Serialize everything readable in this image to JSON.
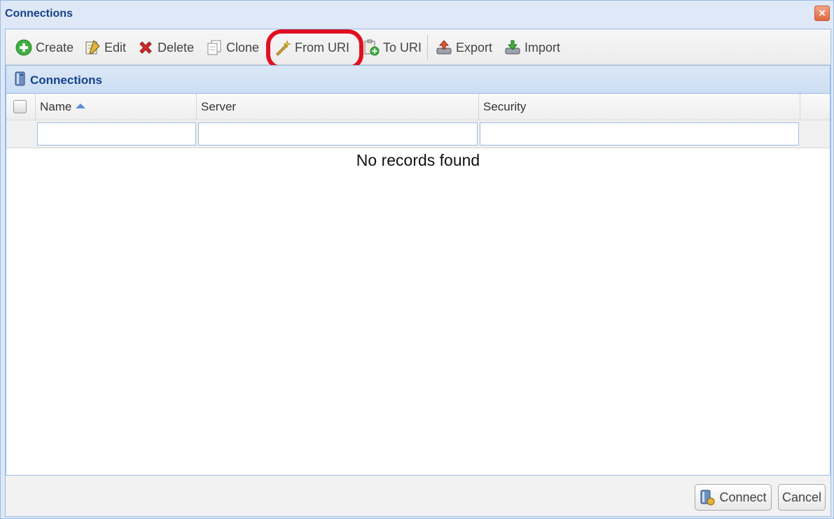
{
  "window": {
    "title": "Connections",
    "close_label": "×"
  },
  "toolbar": {
    "create": {
      "label": "Create",
      "icon": "add-circle-icon"
    },
    "edit": {
      "label": "Edit",
      "icon": "edit-pencil-icon"
    },
    "delete": {
      "label": "Delete",
      "icon": "delete-x-icon"
    },
    "clone": {
      "label": "Clone",
      "icon": "clone-document-icon"
    },
    "from_uri": {
      "label": "From URI",
      "icon": "from-uri-wand-icon"
    },
    "to_uri": {
      "label": "To URI",
      "icon": "to-uri-clipboard-icon"
    },
    "export": {
      "label": "Export",
      "icon": "export-icon"
    },
    "import": {
      "label": "Import",
      "icon": "import-icon"
    }
  },
  "panel": {
    "title": "Connections",
    "columns": [
      {
        "label": "Name",
        "sorted": "ascending"
      },
      {
        "label": "Server"
      },
      {
        "label": "Security"
      }
    ],
    "filters": {
      "name": "",
      "server": "",
      "security": ""
    },
    "empty_message": "No records found"
  },
  "footer": {
    "connect_label": "Connect",
    "cancel_label": "Cancel"
  },
  "colors": {
    "highlight": "#e01020",
    "title": "#15428b",
    "border": "#99bbe8"
  }
}
